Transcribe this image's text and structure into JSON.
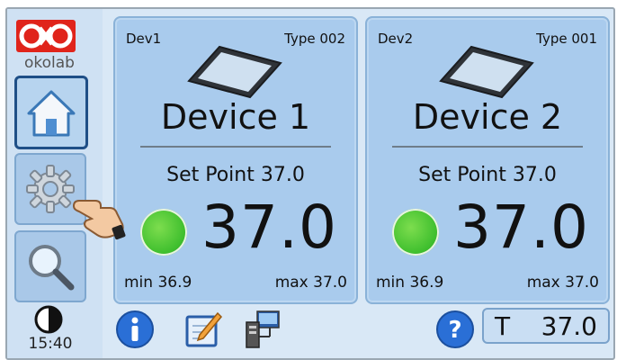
{
  "brand": {
    "logo_text": "okolab"
  },
  "sidebar": {
    "clock": "15:40"
  },
  "devices": [
    {
      "id": "Dev1",
      "type": "Type 002",
      "name": "Device 1",
      "set_point": "Set Point 37.0",
      "value": "37.0",
      "min": "min 36.9",
      "max": "max 37.0",
      "status_color": "#46c232"
    },
    {
      "id": "Dev2",
      "type": "Type 001",
      "name": "Device 2",
      "set_point": "Set Point 37.0",
      "value": "37.0",
      "min": "min 36.9",
      "max": "max 37.0",
      "status_color": "#46c232"
    }
  ],
  "footer": {
    "temp_label": "T",
    "temp_value": "37.0"
  },
  "colors": {
    "accent": "#1f4f87",
    "card": "#a9cbed",
    "background": "#d9e8f6",
    "logo_red": "#e0241b"
  },
  "icons": {
    "home": "home-icon",
    "settings": "gear-icon",
    "search": "magnifier-icon",
    "contrast": "contrast-icon",
    "info": "info-icon",
    "edit": "edit-icon",
    "network": "network-icon",
    "help": "help-icon",
    "device": "tablet-icon",
    "pointer": "hand-pointer-icon"
  }
}
